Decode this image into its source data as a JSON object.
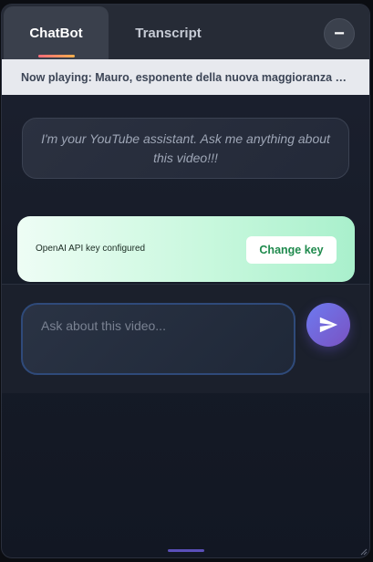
{
  "tabs": [
    {
      "label": "ChatBot",
      "active": true
    },
    {
      "label": "Transcript",
      "active": false
    }
  ],
  "minimize": {
    "icon": "minus-icon",
    "glyph": "−"
  },
  "now_playing": {
    "text": "Now playing: Mauro, esponente della nuova maggioranza - L…"
  },
  "assistant": {
    "message": "I'm your YouTube assistant. Ask me anything about this video!!!"
  },
  "api": {
    "status": "OpenAI API key configured",
    "change_key_label": "Change key"
  },
  "chat_input": {
    "placeholder": "Ask about this video...",
    "value": ""
  },
  "send": {
    "icon": "send-icon"
  },
  "colors": {
    "accent_gradient": [
      "#6d7af0",
      "#7a52c2"
    ],
    "api_success": "#1f8a4d",
    "tab_underline": [
      "#ff6b7a",
      "#f2b04d"
    ]
  }
}
